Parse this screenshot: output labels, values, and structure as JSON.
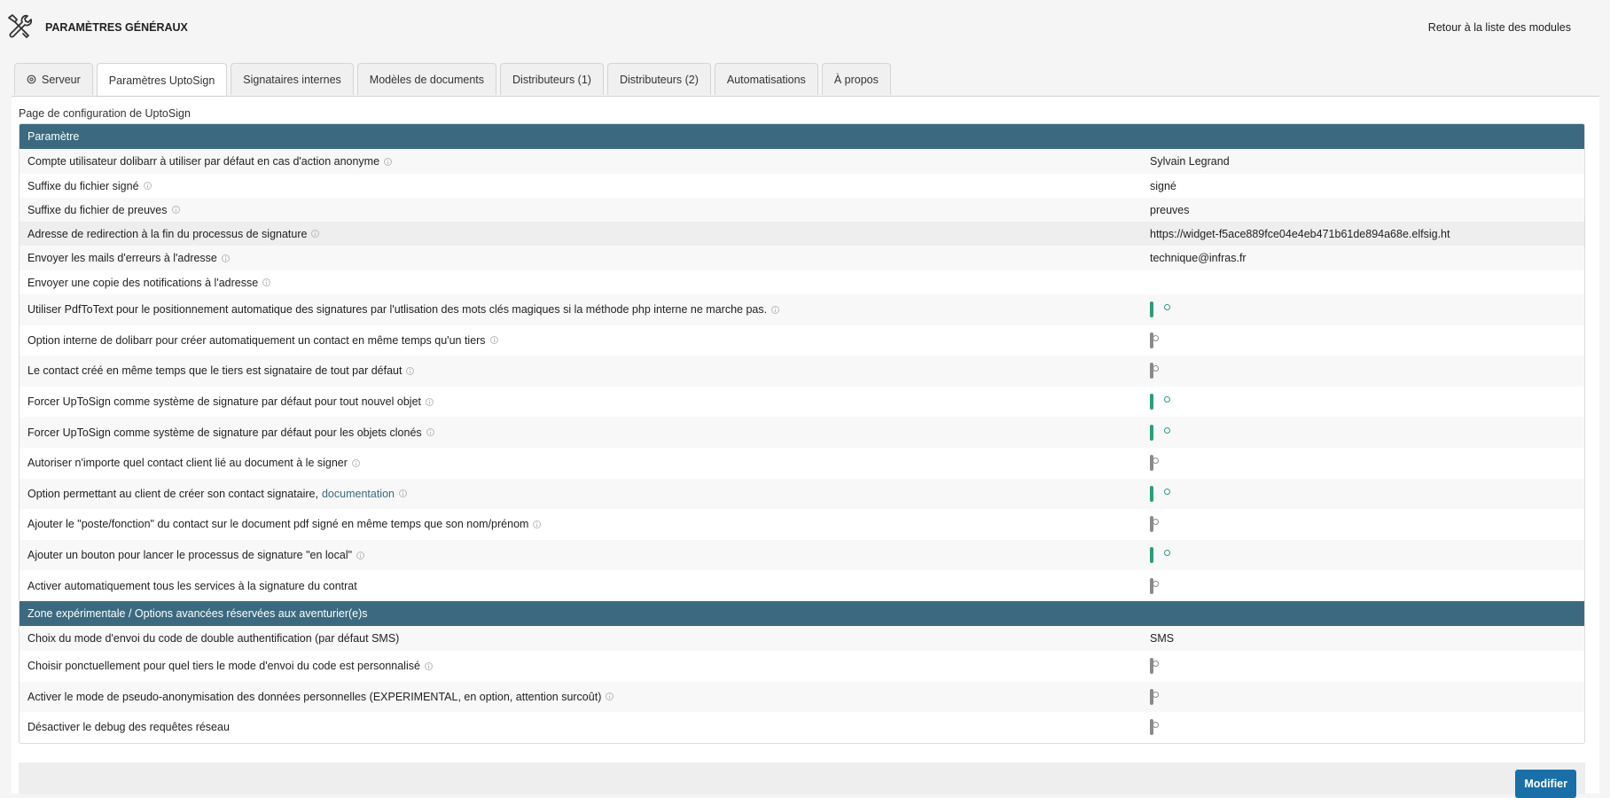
{
  "header": {
    "title": "PARAMÈTRES GÉNÉRAUX",
    "back_link": "Retour à la liste des modules",
    "icon": "tools-icon"
  },
  "tabs": [
    {
      "label": "Serveur",
      "icon": "server-icon",
      "active": false
    },
    {
      "label": "Paramètres UptoSign",
      "active": true
    },
    {
      "label": "Signataires internes",
      "active": false
    },
    {
      "label": "Modèles de documents",
      "active": false
    },
    {
      "label": "Distributeurs (1)",
      "active": false
    },
    {
      "label": "Distributeurs (2)",
      "active": false
    },
    {
      "label": "Automatisations",
      "active": false
    },
    {
      "label": "À propos",
      "active": false
    }
  ],
  "intro": "Page de configuration de UptoSign",
  "section1": {
    "title": "Paramètre",
    "rows": [
      {
        "label": "Compte utilisateur dolibarr à utiliser par défaut en cas d'action anonyme",
        "value": "Sylvain Legrand"
      },
      {
        "label": "Suffixe du fichier signé",
        "value": "signé"
      },
      {
        "label": "Suffixe du fichier de preuves",
        "value": "preuves"
      },
      {
        "label": "Adresse de redirection à la fin du processus de signature",
        "value": "https://widget-f5ace889fce04e4eb471b61de894a68e.elfsig.ht"
      },
      {
        "label": "Envoyer les mails d'erreurs à l'adresse",
        "value": "technique@infras.fr"
      },
      {
        "label": "Envoyer une copie des notifications à l'adresse",
        "value": ""
      }
    ],
    "toggles": [
      {
        "label": "Utiliser PdfToText pour le positionnement automatique des signatures par l'utlisation des mots clés magiques si la méthode php interne ne marche pas.",
        "on": true,
        "info": true
      },
      {
        "label": "Option interne de dolibarr pour créer automatiquement un contact en même temps qu'un tiers",
        "on": false,
        "info": true
      },
      {
        "label": "Le contact créé en même temps que le tiers est signataire de tout par défaut",
        "on": false,
        "info": true
      },
      {
        "label": "Forcer UpToSign comme système de signature par défaut pour tout nouvel objet",
        "on": true,
        "info": true
      },
      {
        "label": "Forcer UpToSign comme système de signature par défaut pour les objets clonés",
        "on": true,
        "info": true
      },
      {
        "label": "Autoriser n'importe quel contact client lié au document à le signer",
        "on": false,
        "info": true
      },
      {
        "label": "Option permettant au client de créer son contact signataire,",
        "link": "documentation",
        "on": true,
        "info": true
      },
      {
        "label": "Ajouter le \"poste/fonction\" du contact sur le document pdf signé en même temps que son nom/prénom",
        "on": false,
        "info": true
      },
      {
        "label": "Ajouter un bouton pour lancer le processus de signature \"en local\"",
        "on": true,
        "info": true
      },
      {
        "label": "Activer automatiquement tous les services à la signature du contrat",
        "on": false,
        "info": false
      }
    ]
  },
  "section2": {
    "title": "Zone expérimentale / Options avancées réservées aux aventurier(e)s",
    "rows": [
      {
        "label": "Choix du mode d'envoi du code de double authentification (par défaut SMS)",
        "value": "SMS"
      }
    ],
    "toggles": [
      {
        "label": "Choisir ponctuellement pour quel tiers le mode d'envoi du code est personnalisé",
        "on": false,
        "info": true
      },
      {
        "label": "Activer le mode de pseudo-anonymisation des données personnelles (EXPERIMENTAL, en option, attention surcoût)",
        "on": false,
        "info": true
      },
      {
        "label": "Désactiver le debug des requêtes réseau",
        "on": false,
        "info": false
      }
    ]
  },
  "save_button": "Modifier",
  "colors": {
    "section_header": "#3b6a80",
    "toggle_on": "#2a9d7a",
    "primary_button": "#1a6fa8"
  }
}
